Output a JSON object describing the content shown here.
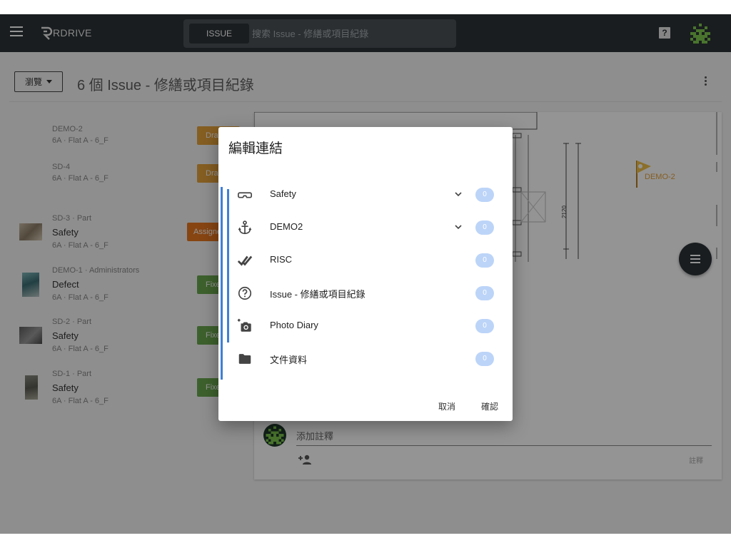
{
  "topbar": {
    "logo_text": "RDRIVE",
    "search_chip": "ISSUE",
    "search_placeholder": "搜索 Issue - 修繕或項目紀錄",
    "help_icon": "?"
  },
  "header": {
    "browse_label": "瀏覽",
    "title": "6 個 Issue - 修繕或項目紀錄"
  },
  "issues": [
    {
      "id_line": "DEMO-2",
      "title": "",
      "sub": "6A · Flat A - 6_F",
      "status": "Draft",
      "status_color": "#e6a23c",
      "has_thumb": false
    },
    {
      "id_line": "SD-4",
      "title": "",
      "sub": "6A · Flat A - 6_F",
      "status": "Draft",
      "status_color": "#e6a23c",
      "has_thumb": false
    },
    {
      "id_line": "SD-3 · Part",
      "title": "Safety",
      "sub": "6A · Flat A - 6_F",
      "status": "Assigned",
      "status_color": "#e8771f",
      "has_thumb": true
    },
    {
      "id_line": "DEMO-1 · Administrators",
      "title": "Defect",
      "sub": "6A · Flat A - 6_F",
      "status": "Fixed",
      "status_color": "#6aa84f",
      "has_thumb": true
    },
    {
      "id_line": "SD-2 · Part",
      "title": "Safety",
      "sub": "6A · Flat A - 6_F",
      "status": "Fixed",
      "status_color": "#6aa84f",
      "has_thumb": true
    },
    {
      "id_line": "SD-1 · Part",
      "title": "Safety",
      "sub": "6A · Flat A - 6_F",
      "status": "Fixed",
      "status_color": "#6aa84f",
      "has_thumb": true
    }
  ],
  "drawing": {
    "marker_label": "DEMO-2",
    "dimension_label": "2120"
  },
  "comment": {
    "placeholder": "添加註釋",
    "submit_label": "註釋"
  },
  "dialog": {
    "title": "編輯連結",
    "rows": [
      {
        "icon": "vr-goggles-icon",
        "label": "Safety",
        "expandable": true,
        "count": "0"
      },
      {
        "icon": "anchor-icon",
        "label": "DEMO2",
        "expandable": true,
        "count": "0"
      },
      {
        "icon": "double-check-icon",
        "label": "RISC",
        "expandable": false,
        "count": "0"
      },
      {
        "icon": "help-circle-icon",
        "label": "Issue - 修繕或項目紀錄",
        "expandable": false,
        "count": "0"
      },
      {
        "icon": "add-photo-icon",
        "label": "Photo Diary",
        "expandable": false,
        "count": "0"
      },
      {
        "icon": "folder-icon",
        "label": "文件資料",
        "expandable": false,
        "count": "0"
      }
    ],
    "cancel_label": "取消",
    "confirm_label": "確認"
  },
  "colors": {
    "topbar": "#2c3236",
    "accent_blue": "#3f7fd6",
    "badge": "#bcd4f8",
    "draft": "#e6a23c",
    "assigned": "#e8771f",
    "fixed": "#6aa84f"
  }
}
